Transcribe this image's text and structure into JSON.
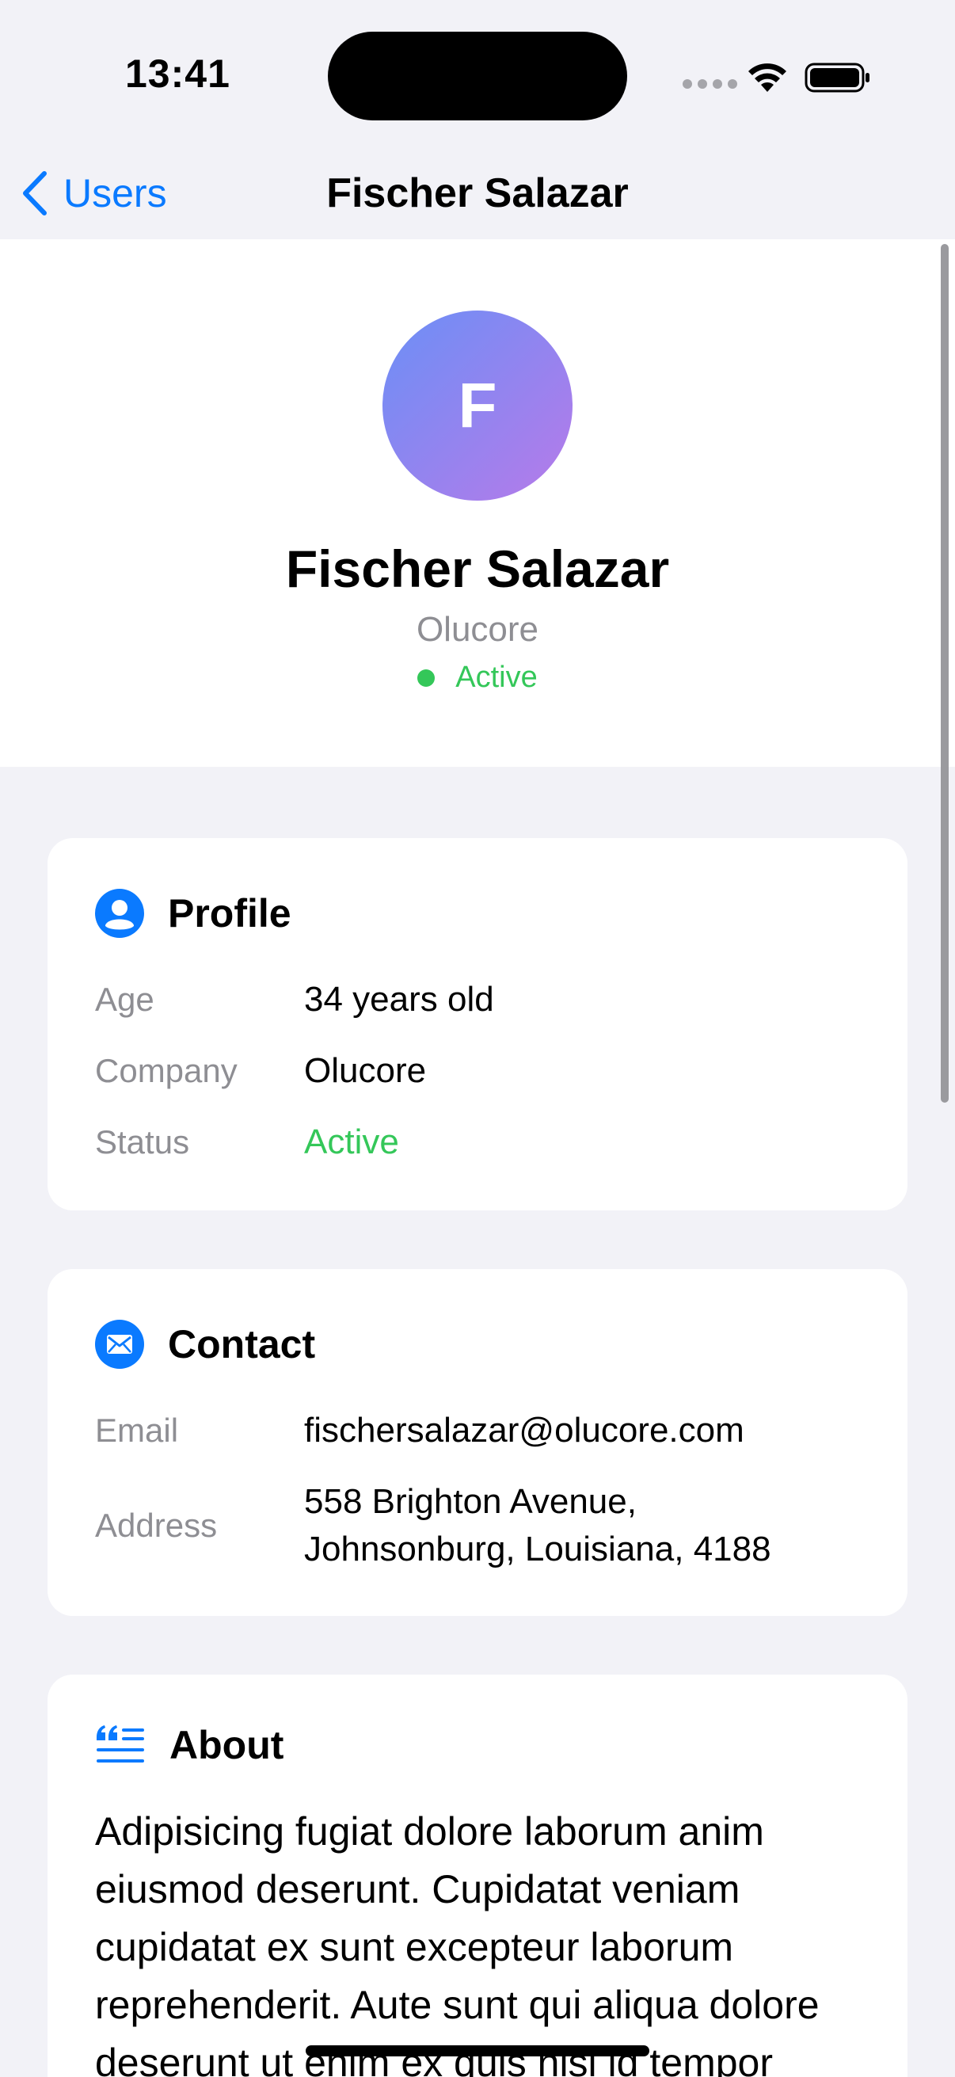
{
  "status_bar": {
    "time": "13:41"
  },
  "nav": {
    "back_label": "Users",
    "title": "Fischer Salazar"
  },
  "header": {
    "avatar_initial": "F",
    "name": "Fischer Salazar",
    "company": "Olucore",
    "status": "Active"
  },
  "profile": {
    "title": "Profile",
    "rows": [
      {
        "label": "Age",
        "value": "34 years old"
      },
      {
        "label": "Company",
        "value": "Olucore"
      },
      {
        "label": "Status",
        "value": "Active"
      }
    ]
  },
  "contact": {
    "title": "Contact",
    "rows": [
      {
        "label": "Email",
        "value": "fischersalazar@olucore.com"
      },
      {
        "label": "Address",
        "value": "558 Brighton Avenue, Johnsonburg, Louisiana, 4188"
      }
    ]
  },
  "about": {
    "title": "About",
    "text": "Adipisicing fugiat dolore laborum anim eiusmod deserunt. Cupidatat veniam cupidatat ex sunt excepteur laborum reprehenderit. Aute sunt qui aliqua dolore deserunt ut enim ex quis nisi id tempor"
  },
  "colors": {
    "accent": "#0a7aff",
    "active_green": "#34c759",
    "secondary_text": "#8e8e93",
    "background": "#f2f2f7"
  }
}
